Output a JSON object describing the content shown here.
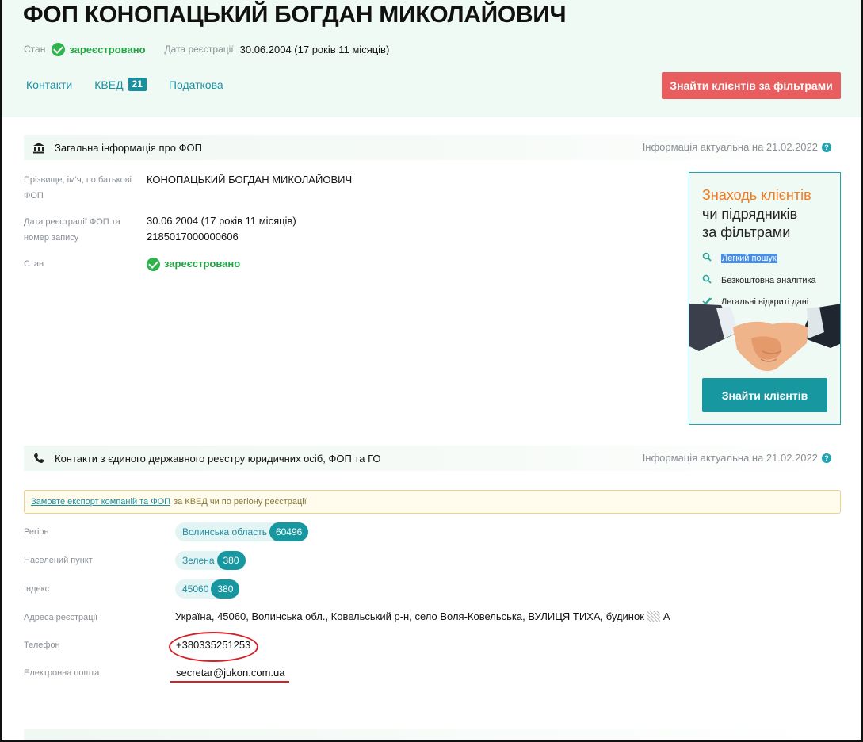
{
  "header": {
    "title": "ФОП КОНОПАЦЬКИЙ БОГДАН МИКОЛАЙОВИЧ",
    "status_label": "Стан",
    "status_value": "зареєстровано",
    "reg_date_label": "Дата реєстрації",
    "reg_date_value": "30.06.2004 (17 років 11 місяців)",
    "tabs": [
      {
        "label": "Контакти"
      },
      {
        "label": "КВЕД",
        "badge": "21"
      },
      {
        "label": "Податкова"
      }
    ],
    "cta_label": "Знайти клієнтів за фільтрами"
  },
  "general": {
    "heading": "Загальна інформація про ФОП",
    "actual": "Інформація актуальна на 21.02.2022",
    "rows": [
      {
        "label": "Прізвище, ім'я, по батькові ФОП",
        "value": "КОНОПАЦЬКИЙ БОГДАН МИКОЛАЙОВИЧ"
      },
      {
        "label": "Дата реєстрації ФОП та номер запису",
        "value": "30.06.2004 (17 років 11 місяців)",
        "value2": "2185017000000606"
      },
      {
        "label": "Стан",
        "value": "зареєстровано"
      }
    ]
  },
  "ad": {
    "title_accent": "Знаходь клієнтів",
    "title_line2": "чи підрядників",
    "title_line3": "за фільтрами",
    "items": [
      "Легкий пошук",
      "Безкоштовна аналітика",
      "Легальні відкриті дані"
    ],
    "button": "Знайти клієнтів"
  },
  "contacts": {
    "heading": "Контакти з єдиного державного реєстру юридичних осіб, ФОП та ГО",
    "actual": "Інформація актуальна на 21.02.2022",
    "notice_link": "Замовте експорт компаній та ФОП",
    "notice_text": "за КВЕД чи по регіону реєстрації",
    "region_label": "Регіон",
    "region_value": "Волинська область",
    "region_count": "60496",
    "locality_label": "Населений пункт",
    "locality_value": "Зелена",
    "locality_count": "380",
    "index_label": "Індекс",
    "index_value": "45060",
    "index_count": "380",
    "address_label": "Адреса реєстрації",
    "address_value": "Україна, 45060, Волинська обл., Ковельський р-н, село Воля-Ковельська, ВУЛИЦЯ ТИХА, будинок",
    "address_suffix": "А",
    "phone_label": "Телефон",
    "phone_value": "+380335251253",
    "email_label": "Електронна пошта",
    "email_value": "secretar@jukon.com.ua"
  },
  "colors": {
    "accent": "#1f8fa0",
    "cta_red": "#e85d5d",
    "status_green": "#24a446",
    "annotation_red": "#d81f26"
  }
}
